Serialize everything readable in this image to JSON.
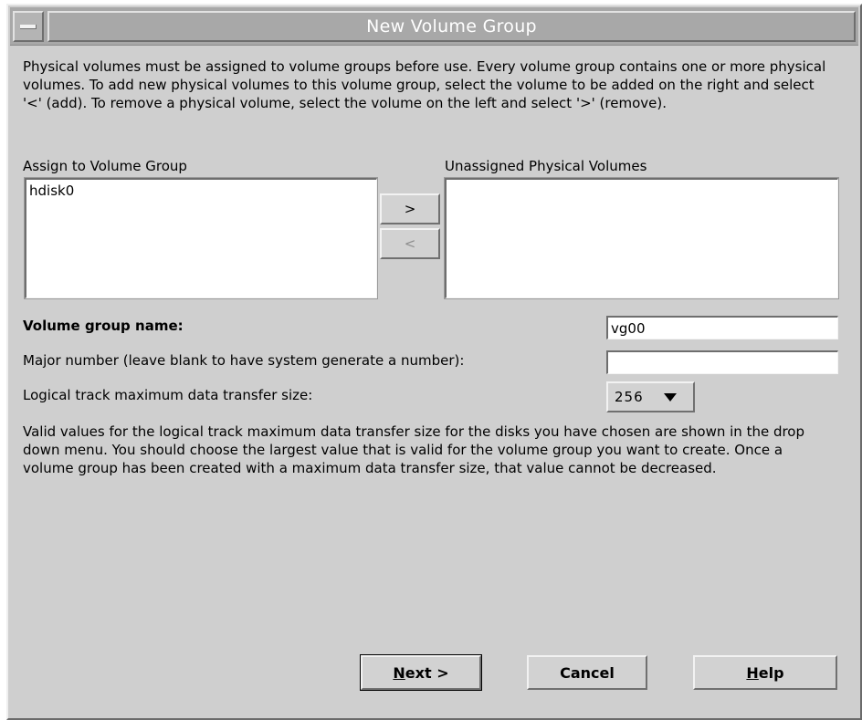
{
  "window": {
    "title": "New Volume Group"
  },
  "intro_text": "Physical volumes must be assigned to volume groups before use. Every volume group contains one or more physical volumes. To add new physical volumes to this volume group, select the volume to be added on the right and select '<' (add).  To remove a physical volume, select the volume on the left and select '>' (remove).",
  "assigned": {
    "label": "Assign to Volume Group",
    "items": [
      "hdisk0"
    ]
  },
  "unassigned": {
    "label": "Unassigned Physical Volumes",
    "items": []
  },
  "move_buttons": {
    "remove": ">",
    "add": "<"
  },
  "form": {
    "vg_name_label": "Volume group name:",
    "vg_name_value": "vg00",
    "major_label": "Major number (leave blank to have system generate a number):",
    "major_value": "",
    "ltg_label": "Logical track maximum data transfer size:",
    "ltg_value": "256"
  },
  "help_text": "Valid values for the logical track maximum data transfer size for the disks you have chosen are shown in the drop down menu. You should choose the largest value that is valid for the volume group you want to create. Once a volume group has been created with a maximum data transfer size, that value cannot be decreased.",
  "buttons": {
    "next_mnemonic": "N",
    "next_rest": "ext >",
    "cancel": "Cancel",
    "help_mnemonic": "H",
    "help_rest": "elp"
  },
  "icons": {
    "window_menu": "window-menu-icon",
    "dropdown": "caret-down-icon"
  }
}
